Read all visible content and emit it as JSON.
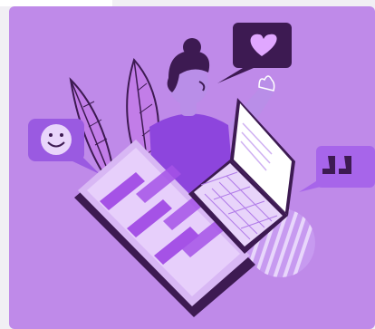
{
  "illustration": {
    "palette": {
      "card": "#bf8ae9",
      "deep": "#3d1a52",
      "primary": "#9b55e0",
      "light": "#d8b7f4",
      "skin": "#b98ee8"
    },
    "icons": [
      "heart-chat-icon",
      "smiley-chat-icon",
      "quote-chat-icon",
      "laptop-icon",
      "tablet-icon",
      "leaf-icon",
      "person-icon"
    ]
  }
}
